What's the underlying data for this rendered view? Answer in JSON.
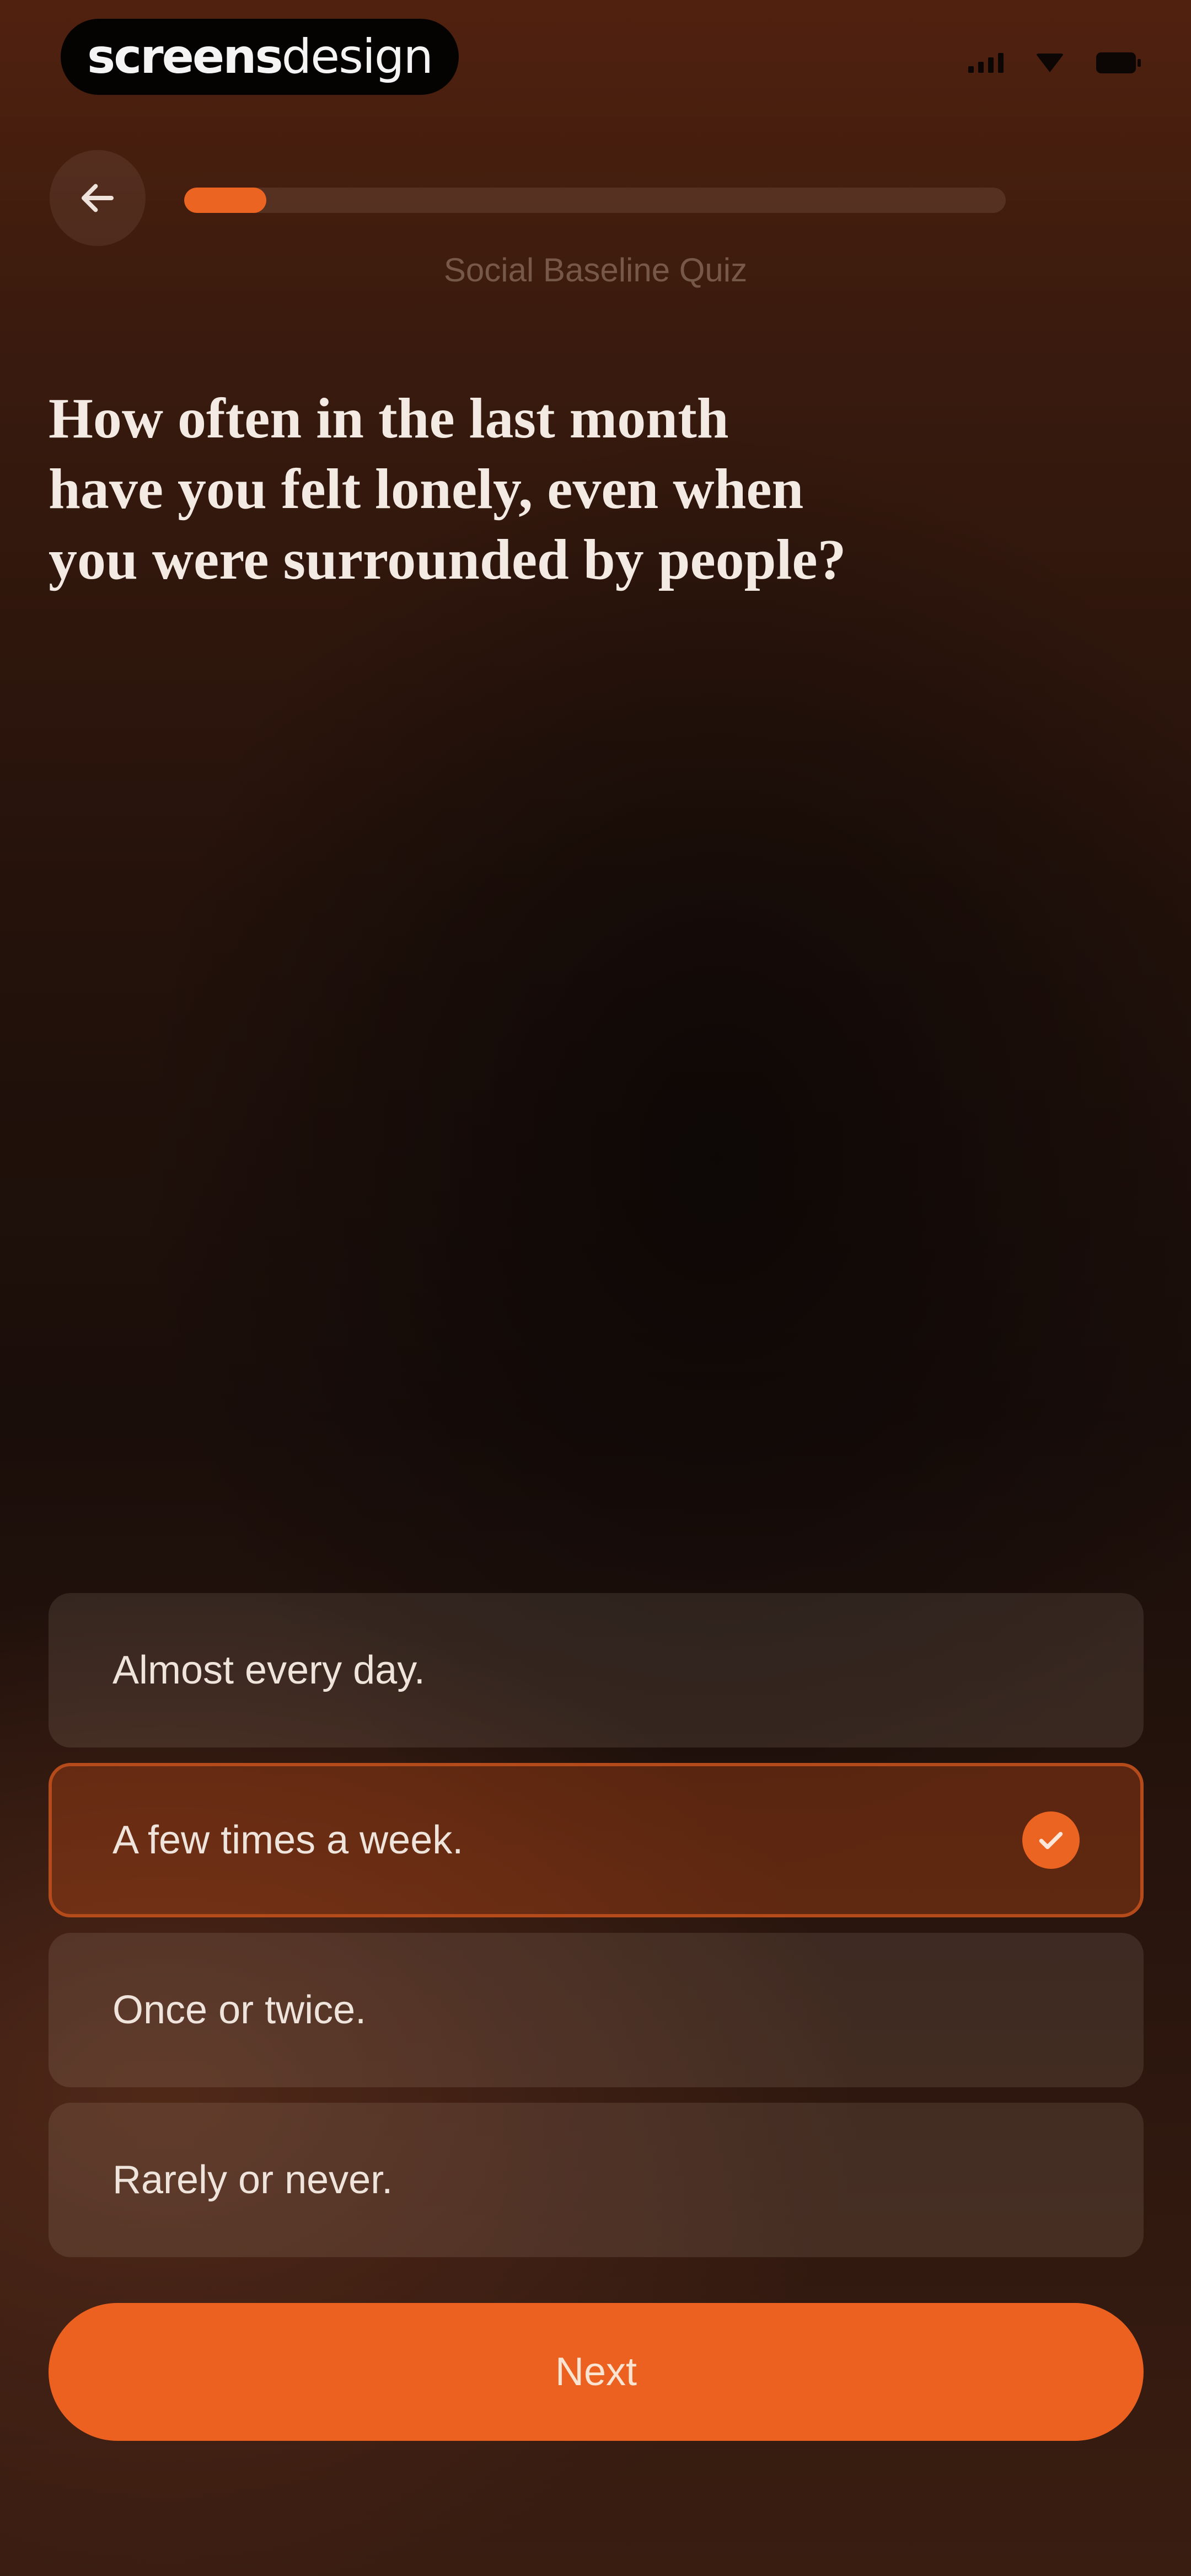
{
  "status_bar": {
    "logo_strong": "screens",
    "logo_light": "design",
    "icons": [
      "cellular-signal-icon",
      "wifi-icon",
      "battery-icon"
    ]
  },
  "header": {
    "back_icon": "arrow-left-icon",
    "progress_fraction": 0.1,
    "quiz_title": "Social Baseline Quiz"
  },
  "question": {
    "text": "How often in the last month have you felt lonely, even when you were surrounded by people?"
  },
  "options": [
    {
      "label": "Almost every day.",
      "selected": false
    },
    {
      "label": "A few times a week.",
      "selected": true
    },
    {
      "label": "Once or twice.",
      "selected": false
    },
    {
      "label": "Rarely or never.",
      "selected": false
    }
  ],
  "actions": {
    "next_label": "Next"
  },
  "colors": {
    "accent": "#ec6421",
    "background_top": "#51210f",
    "background_mid": "#1a0e0a",
    "text_primary": "#f3eae3"
  }
}
